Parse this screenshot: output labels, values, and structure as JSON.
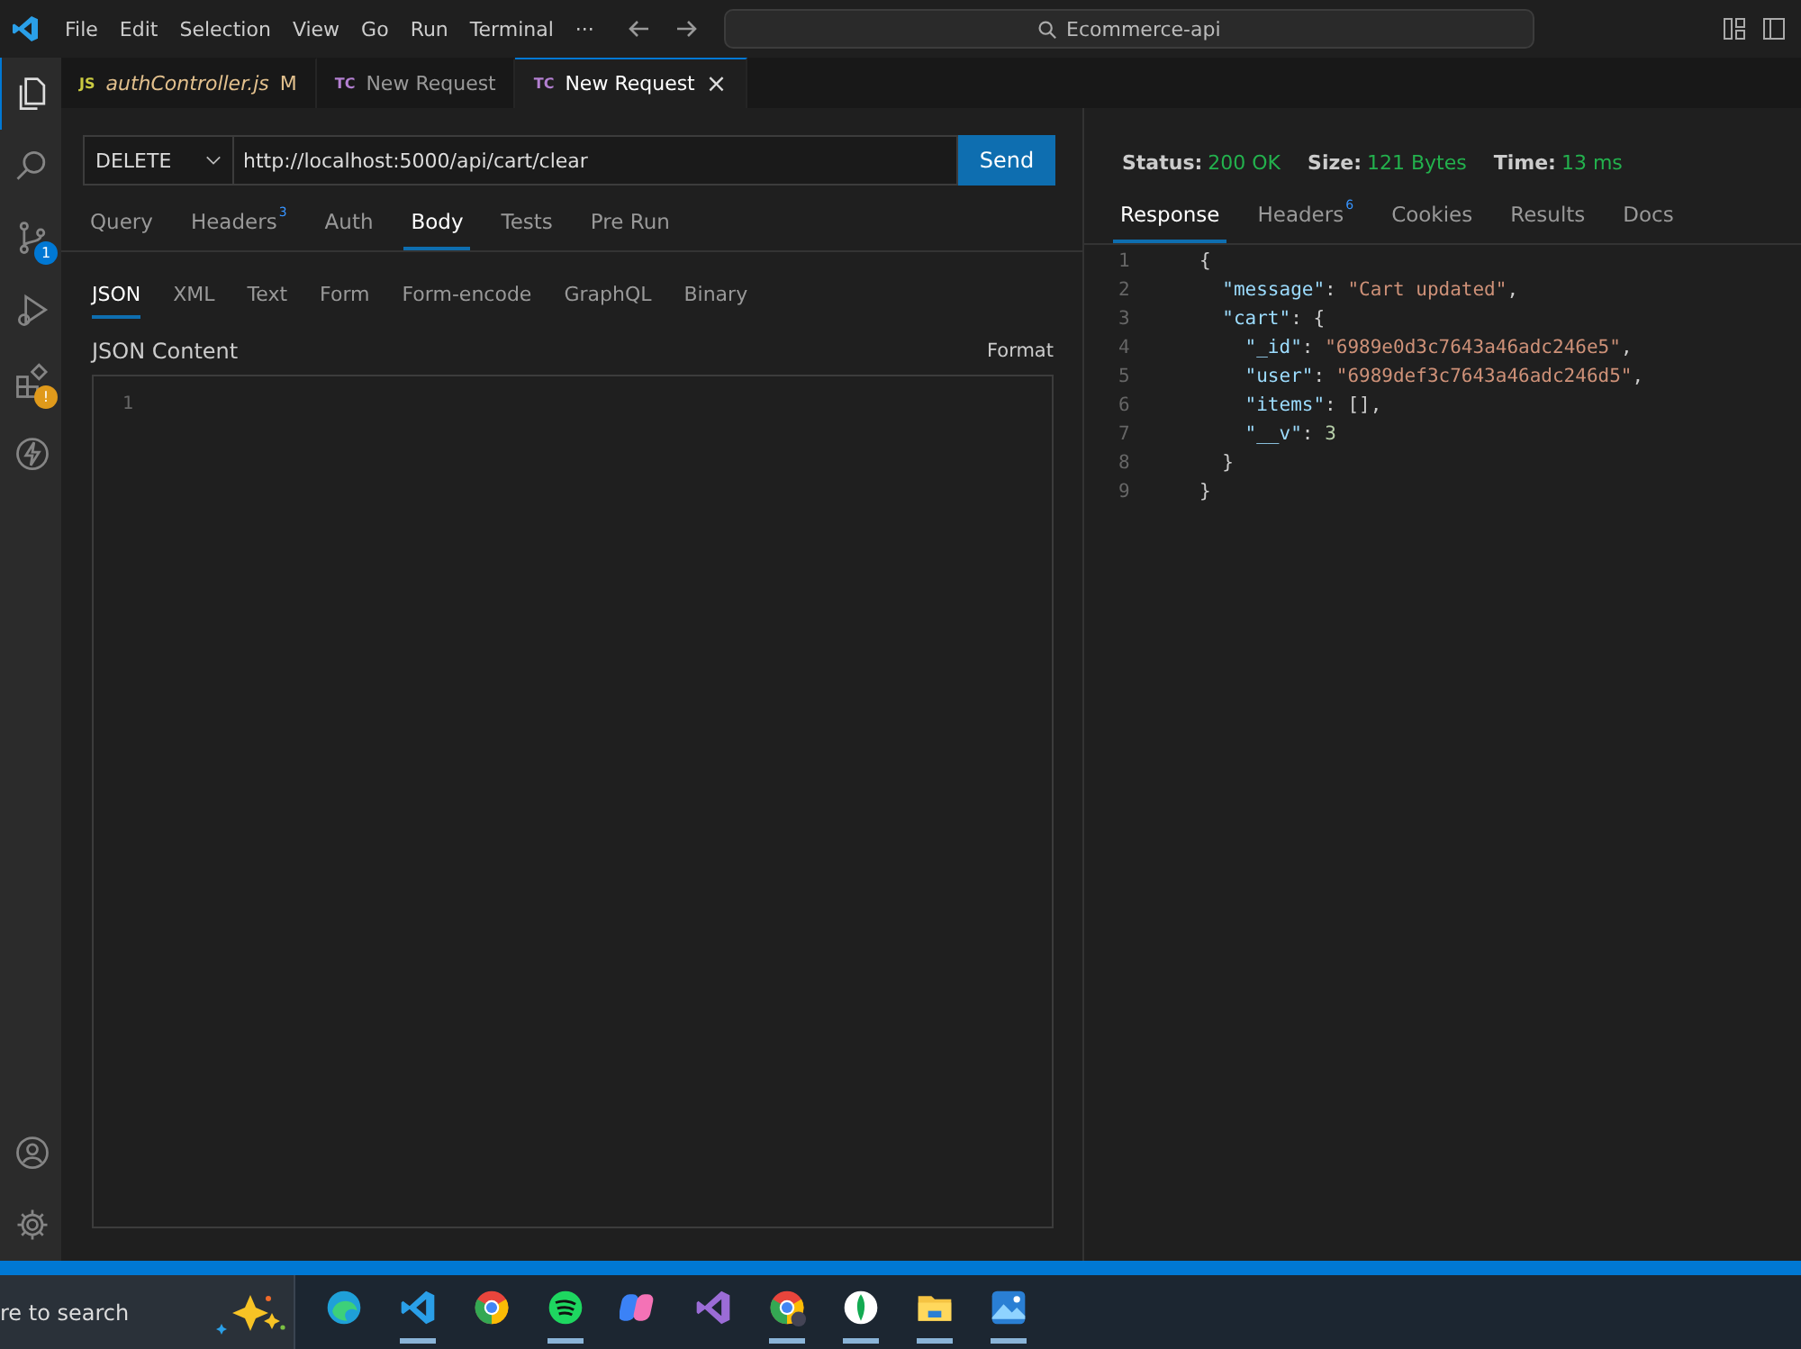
{
  "title_bar": {
    "menu": [
      "File",
      "Edit",
      "Selection",
      "View",
      "Go",
      "Run",
      "Terminal",
      "···"
    ],
    "search": "Ecommerce-api"
  },
  "activity_bar": [
    {
      "kind": "files",
      "selected": true
    },
    {
      "kind": "search",
      "selected": false
    },
    {
      "kind": "source-control",
      "selected": false,
      "badge": "1"
    },
    {
      "kind": "run",
      "selected": false
    },
    {
      "kind": "extensions",
      "selected": false,
      "badge": "!"
    },
    {
      "kind": "bolt",
      "selected": false
    }
  ],
  "activity_bottom": [
    {
      "kind": "account"
    },
    {
      "kind": "gear"
    }
  ],
  "tabs": [
    {
      "icon": "JS",
      "label": "authController.js",
      "modified": "M",
      "selected": false
    },
    {
      "icon": "TC",
      "label": "New Request",
      "selected": false
    },
    {
      "icon": "TC",
      "label": "New Request",
      "selected": true,
      "close": "×"
    }
  ],
  "request": {
    "method": "DELETE",
    "url": "http://localhost:5000/api/cart/clear",
    "send": "Send",
    "tabs": [
      {
        "label": "Query",
        "selected": false
      },
      {
        "label": "Headers",
        "count": "3",
        "selected": false
      },
      {
        "label": "Auth",
        "selected": false
      },
      {
        "label": "Body",
        "selected": true
      },
      {
        "label": "Tests",
        "selected": false
      },
      {
        "label": "Pre Run",
        "selected": false
      }
    ],
    "body_tabs": [
      {
        "label": "JSON",
        "selected": true
      },
      {
        "label": "XML",
        "selected": false
      },
      {
        "label": "Text",
        "selected": false
      },
      {
        "label": "Form",
        "selected": false
      },
      {
        "label": "Form-encode",
        "selected": false
      },
      {
        "label": "GraphQL",
        "selected": false
      },
      {
        "label": "Binary",
        "selected": false
      }
    ],
    "content_label": "JSON Content",
    "format": "Format",
    "line_numbers": [
      "1"
    ]
  },
  "response": {
    "status_label": "Status:",
    "status": "200 OK",
    "size_label": "Size:",
    "size": "121 Bytes",
    "time_label": "Time:",
    "time": "13 ms",
    "tabs": [
      {
        "label": "Response",
        "selected": true
      },
      {
        "label": "Headers",
        "count": "6",
        "selected": false
      },
      {
        "label": "Cookies",
        "selected": false
      },
      {
        "label": "Results",
        "selected": false
      },
      {
        "label": "Docs",
        "selected": false
      }
    ],
    "lines": [
      {
        "n": "1",
        "tokens": [
          {
            "kind": "punct",
            "text": "{"
          }
        ]
      },
      {
        "n": "2",
        "tokens": [
          {
            "kind": "key",
            "text": "  \"message\""
          },
          {
            "kind": "punct",
            "text": ": "
          },
          {
            "kind": "string",
            "text": "\"Cart updated\""
          },
          {
            "kind": "punct",
            "text": ","
          }
        ]
      },
      {
        "n": "3",
        "tokens": [
          {
            "kind": "key",
            "text": "  \"cart\""
          },
          {
            "kind": "punct",
            "text": ": {"
          }
        ]
      },
      {
        "n": "4",
        "tokens": [
          {
            "kind": "key",
            "text": "    \"_id\""
          },
          {
            "kind": "punct",
            "text": ": "
          },
          {
            "kind": "string",
            "text": "\"6989e0d3c7643a46adc246e5\""
          },
          {
            "kind": "punct",
            "text": ","
          }
        ]
      },
      {
        "n": "5",
        "tokens": [
          {
            "kind": "key",
            "text": "    \"user\""
          },
          {
            "kind": "punct",
            "text": ": "
          },
          {
            "kind": "string",
            "text": "\"6989def3c7643a46adc246d5\""
          },
          {
            "kind": "punct",
            "text": ","
          }
        ]
      },
      {
        "n": "6",
        "tokens": [
          {
            "kind": "key",
            "text": "    \"items\""
          },
          {
            "kind": "punct",
            "text": ": [],"
          }
        ]
      },
      {
        "n": "7",
        "tokens": [
          {
            "kind": "key",
            "text": "    \"__v\""
          },
          {
            "kind": "punct",
            "text": ": "
          },
          {
            "kind": "number",
            "text": "3"
          }
        ]
      },
      {
        "n": "8",
        "tokens": [
          {
            "kind": "punct",
            "text": "  }"
          }
        ]
      },
      {
        "n": "9",
        "tokens": [
          {
            "kind": "punct",
            "text": "}"
          }
        ]
      }
    ]
  },
  "taskbar": {
    "search": "re to search",
    "apps": [
      {
        "kind": "edge",
        "running": false
      },
      {
        "kind": "vscode",
        "running": true
      },
      {
        "kind": "chrome",
        "running": false
      },
      {
        "kind": "spotify",
        "running": true
      },
      {
        "kind": "copilot",
        "running": false
      },
      {
        "kind": "vs",
        "running": false
      },
      {
        "kind": "chrome-profile",
        "running": true
      },
      {
        "kind": "mongo",
        "running": true
      },
      {
        "kind": "explorer",
        "running": true
      },
      {
        "kind": "photos",
        "running": true
      }
    ]
  }
}
